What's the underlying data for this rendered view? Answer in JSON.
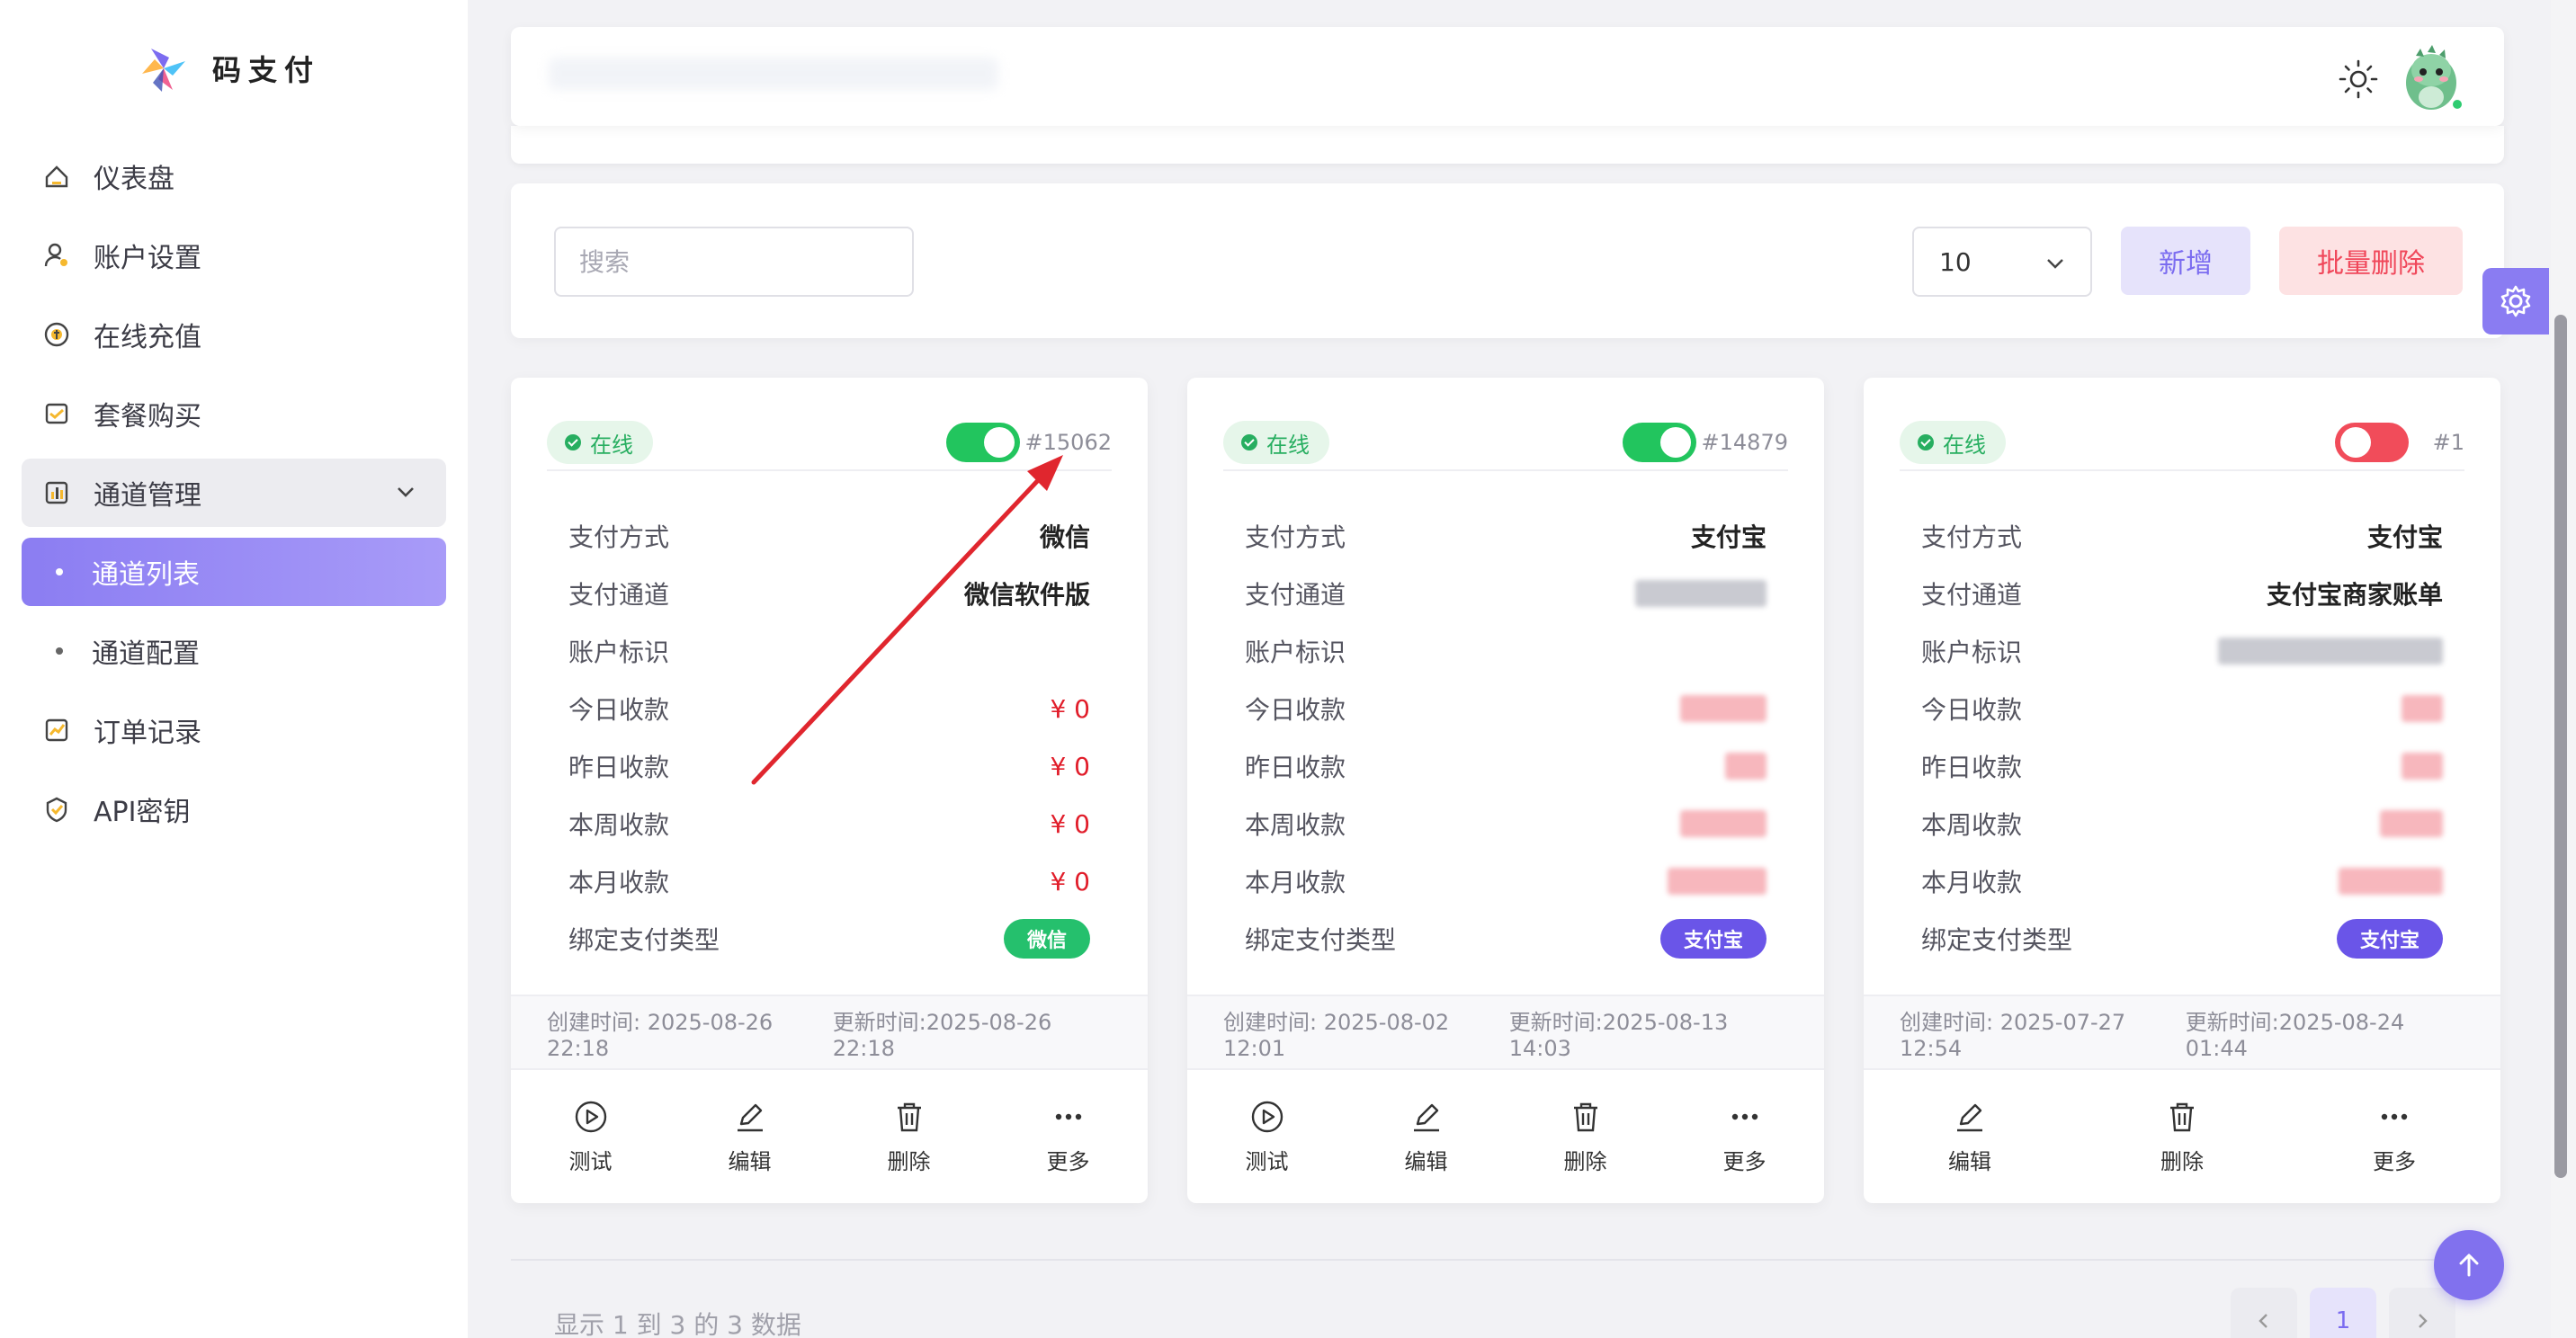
{
  "brand": {
    "name": "码支付"
  },
  "sidebar": {
    "items": [
      {
        "label": "仪表盘",
        "icon": "dashboard-icon"
      },
      {
        "label": "账户设置",
        "icon": "user-settings-icon"
      },
      {
        "label": "在线充值",
        "icon": "recharge-icon"
      },
      {
        "label": "套餐购买",
        "icon": "package-icon"
      },
      {
        "label": "通道管理",
        "icon": "chart-icon"
      },
      {
        "label": "通道列表"
      },
      {
        "label": "通道配置"
      },
      {
        "label": "订单记录",
        "icon": "orders-icon"
      },
      {
        "label": "API密钥",
        "icon": "key-icon"
      }
    ]
  },
  "toolbar": {
    "search_placeholder": "搜索",
    "page_size": "10",
    "add_label": "新增",
    "batch_delete_label": "批量删除"
  },
  "labels": {
    "pay_method": "支付方式",
    "pay_channel": "支付通道",
    "account_id": "账户标识",
    "today": "今日收款",
    "yesterday": "昨日收款",
    "week": "本周收款",
    "month": "本月收款",
    "bind_type": "绑定支付类型"
  },
  "actions": {
    "test": "测试",
    "edit": "编辑",
    "delete": "删除",
    "more": "更多"
  },
  "cards": [
    {
      "status": "在线",
      "enabled": true,
      "id": "#15062",
      "pay_method": "微信",
      "pay_channel": "微信软件版",
      "account_id": "",
      "today": "¥ 0",
      "yesterday": "¥ 0",
      "week": "¥ 0",
      "month": "¥ 0",
      "bind_type": "微信",
      "created": "创建时间: 2025-08-26 22:18",
      "updated": "更新时间:2025-08-26 22:18"
    },
    {
      "status": "在线",
      "enabled": true,
      "id": "#14879",
      "pay_method": "支付宝",
      "bind_type": "支付宝",
      "created": "创建时间: 2025-08-02 12:01",
      "updated": "更新时间:2025-08-13 14:03"
    },
    {
      "status": "在线",
      "enabled": false,
      "id": "#1",
      "pay_method": "支付宝",
      "pay_channel": "支付宝商家账单",
      "bind_type": "支付宝",
      "created": "创建时间: 2025-07-27 12:54",
      "updated": "更新时间:2025-08-24 01:44"
    }
  ],
  "footer": {
    "info": "显示 1 到 3 的 3 数据",
    "page": "1"
  },
  "colors": {
    "accent": "#8171ee",
    "online": "#22c55e",
    "danger": "#f14c5a",
    "money": "#e11d2a",
    "annotation_arrow": "#e0262e"
  }
}
